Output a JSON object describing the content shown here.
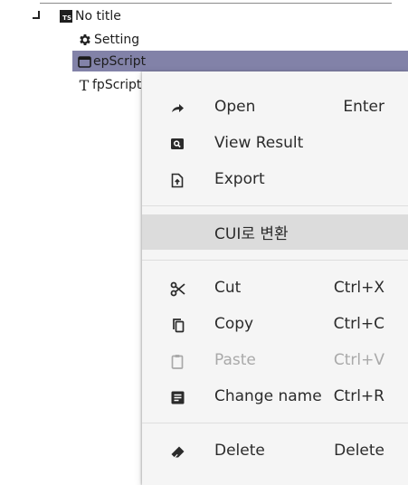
{
  "tree": {
    "root_label": "No title",
    "root_icon_text": "TS",
    "children": [
      {
        "label": "Setting",
        "icon": "gear-icon"
      },
      {
        "label": "epScript",
        "icon": "window-icon",
        "selected": true
      },
      {
        "label": "fpScript",
        "icon": "text-t-icon"
      }
    ],
    "selection_color": "#8282a8"
  },
  "menu": {
    "open": {
      "label": "Open",
      "shortcut": "Enter",
      "icon": "arrow-forward-icon"
    },
    "view_result": {
      "label": "View Result",
      "icon": "search-window-icon"
    },
    "export": {
      "label": "Export",
      "icon": "file-upload-icon"
    },
    "convert_cui": {
      "label": "CUI로 변환",
      "highlighted": true
    },
    "cut": {
      "label": "Cut",
      "shortcut": "Ctrl+X",
      "icon": "scissors-icon"
    },
    "copy": {
      "label": "Copy",
      "shortcut": "Ctrl+C",
      "icon": "copy-icon"
    },
    "paste": {
      "label": "Paste",
      "shortcut": "Ctrl+V",
      "icon": "clipboard-icon",
      "disabled": true
    },
    "change_name": {
      "label": "Change name",
      "shortcut": "Ctrl+R",
      "icon": "rename-icon"
    },
    "delete": {
      "label": "Delete",
      "shortcut": "Delete",
      "icon": "eraser-icon"
    }
  }
}
